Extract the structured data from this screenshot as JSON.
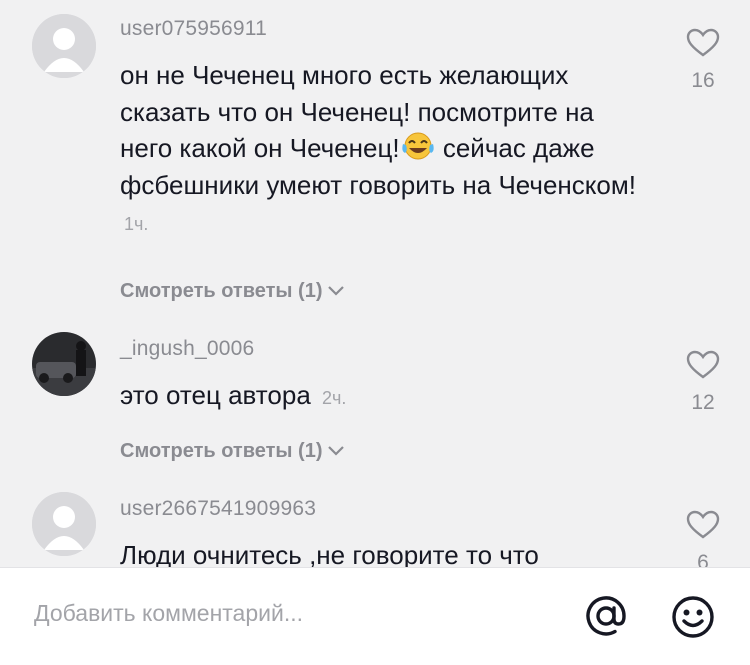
{
  "comments": [
    {
      "username": "user075956911",
      "text": "он не Чеченец много есть желающих сказать что он Чеченец! посмотрите на него какой он Чеченец!",
      "emoji": "tears-of-joy-emoji",
      "text_after": " сейчас даже фсбешники умеют говорить на Чеченском!",
      "time": "1ч.",
      "view_replies": "Смотреть ответы (1)",
      "likes": "16",
      "avatar": "default-avatar-icon"
    },
    {
      "username": "_ingush_0006",
      "text": "это отец автора",
      "time": "2ч.",
      "view_replies": "Смотреть ответы (1)",
      "likes": "12",
      "avatar": "photo-avatar"
    },
    {
      "username": "user2667541909963",
      "text": "Люди очнитесь ,не говорите то что",
      "likes": "6",
      "avatar": "default-avatar-icon"
    }
  ],
  "bottom_bar": {
    "placeholder": "Добавить комментарий...",
    "mention_icon": "at-sign-icon",
    "emoji_icon": "smiley-icon"
  },
  "colors": {
    "background": "#f1f1f2",
    "text": "#161823",
    "secondary_text": "#8a8b91",
    "bar_background": "#ffffff"
  }
}
